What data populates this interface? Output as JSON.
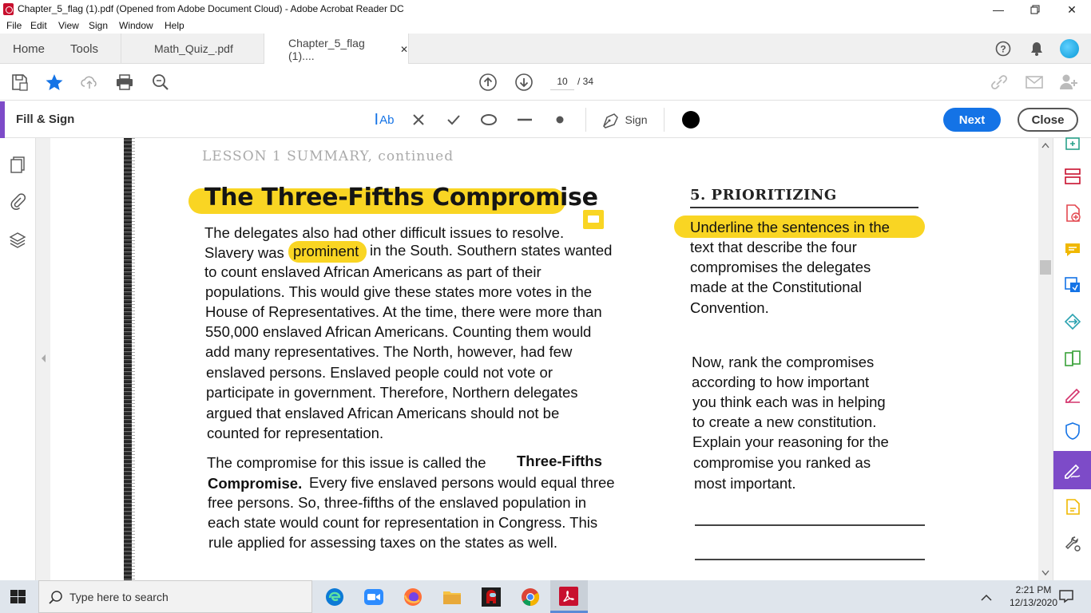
{
  "window": {
    "title": "Chapter_5_flag (1).pdf (Opened from Adobe Document Cloud) - Adobe Acrobat Reader DC"
  },
  "menu": [
    "File",
    "Edit",
    "View",
    "Sign",
    "Window",
    "Help"
  ],
  "nav": {
    "home": "Home",
    "tools": "Tools"
  },
  "tabs": [
    {
      "label": "Math_Quiz_.pdf"
    },
    {
      "label": "Chapter_5_flag (1)....",
      "close": "✕"
    }
  ],
  "pagination": {
    "current": "10",
    "total": "/ 34"
  },
  "fill_sign": {
    "label": "Fill & Sign",
    "text_tool": "Ab",
    "sign_label": "Sign",
    "next_label": "Next",
    "close_label": "Close",
    "ink_color": "#000000"
  },
  "colors": {
    "accent": "#7d4bc8",
    "primary": "#1473e6",
    "highlight": "#f9d523"
  },
  "document": {
    "header_faint": "LESSON 1 SUMMARY, continued",
    "heading": "The Three-Fifths Compromise",
    "paragraph1": [
      "The delegates also had other difficult issues to resolve.",
      "Slavery was",
      "prominent",
      "in the South. Southern states wanted",
      "to count enslaved African Americans as part of their",
      "populations. This would give these states more votes in the",
      "House of Representatives. At the time, there were more than",
      "550,000 enslaved African Americans. Counting them would",
      "add many representatives. The North, however, had few",
      "enslaved persons. Enslaved people could not vote or",
      "participate in government. Therefore, Northern delegates",
      "argued that enslaved African Americans should not be",
      "counted for representation."
    ],
    "paragraph2": [
      "The compromise for this issue is called the",
      "Three-Fifths",
      "Compromise.",
      "Every five enslaved persons would equal three",
      "free persons. So, three-fifths of the enslaved population in",
      "each state would count for representation in Congress. This",
      "rule applied for assessing taxes on the states as well."
    ],
    "sidebar_heading": "5. PRIORITIZING",
    "sidebar_lines1": [
      "Underline the sentences in the",
      "text that describe the four",
      "compromises the delegates",
      "made at the Constitutional",
      "Convention."
    ],
    "sidebar_lines2": [
      "Now, rank the compromises",
      "according to how important",
      "you think each was in helping",
      "to create a new constitution.",
      "Explain your reasoning for the",
      "compromise you ranked as",
      "most important."
    ]
  },
  "taskbar": {
    "search_placeholder": "Type here to search",
    "time": "2:21 PM",
    "date": "12/13/2020"
  }
}
